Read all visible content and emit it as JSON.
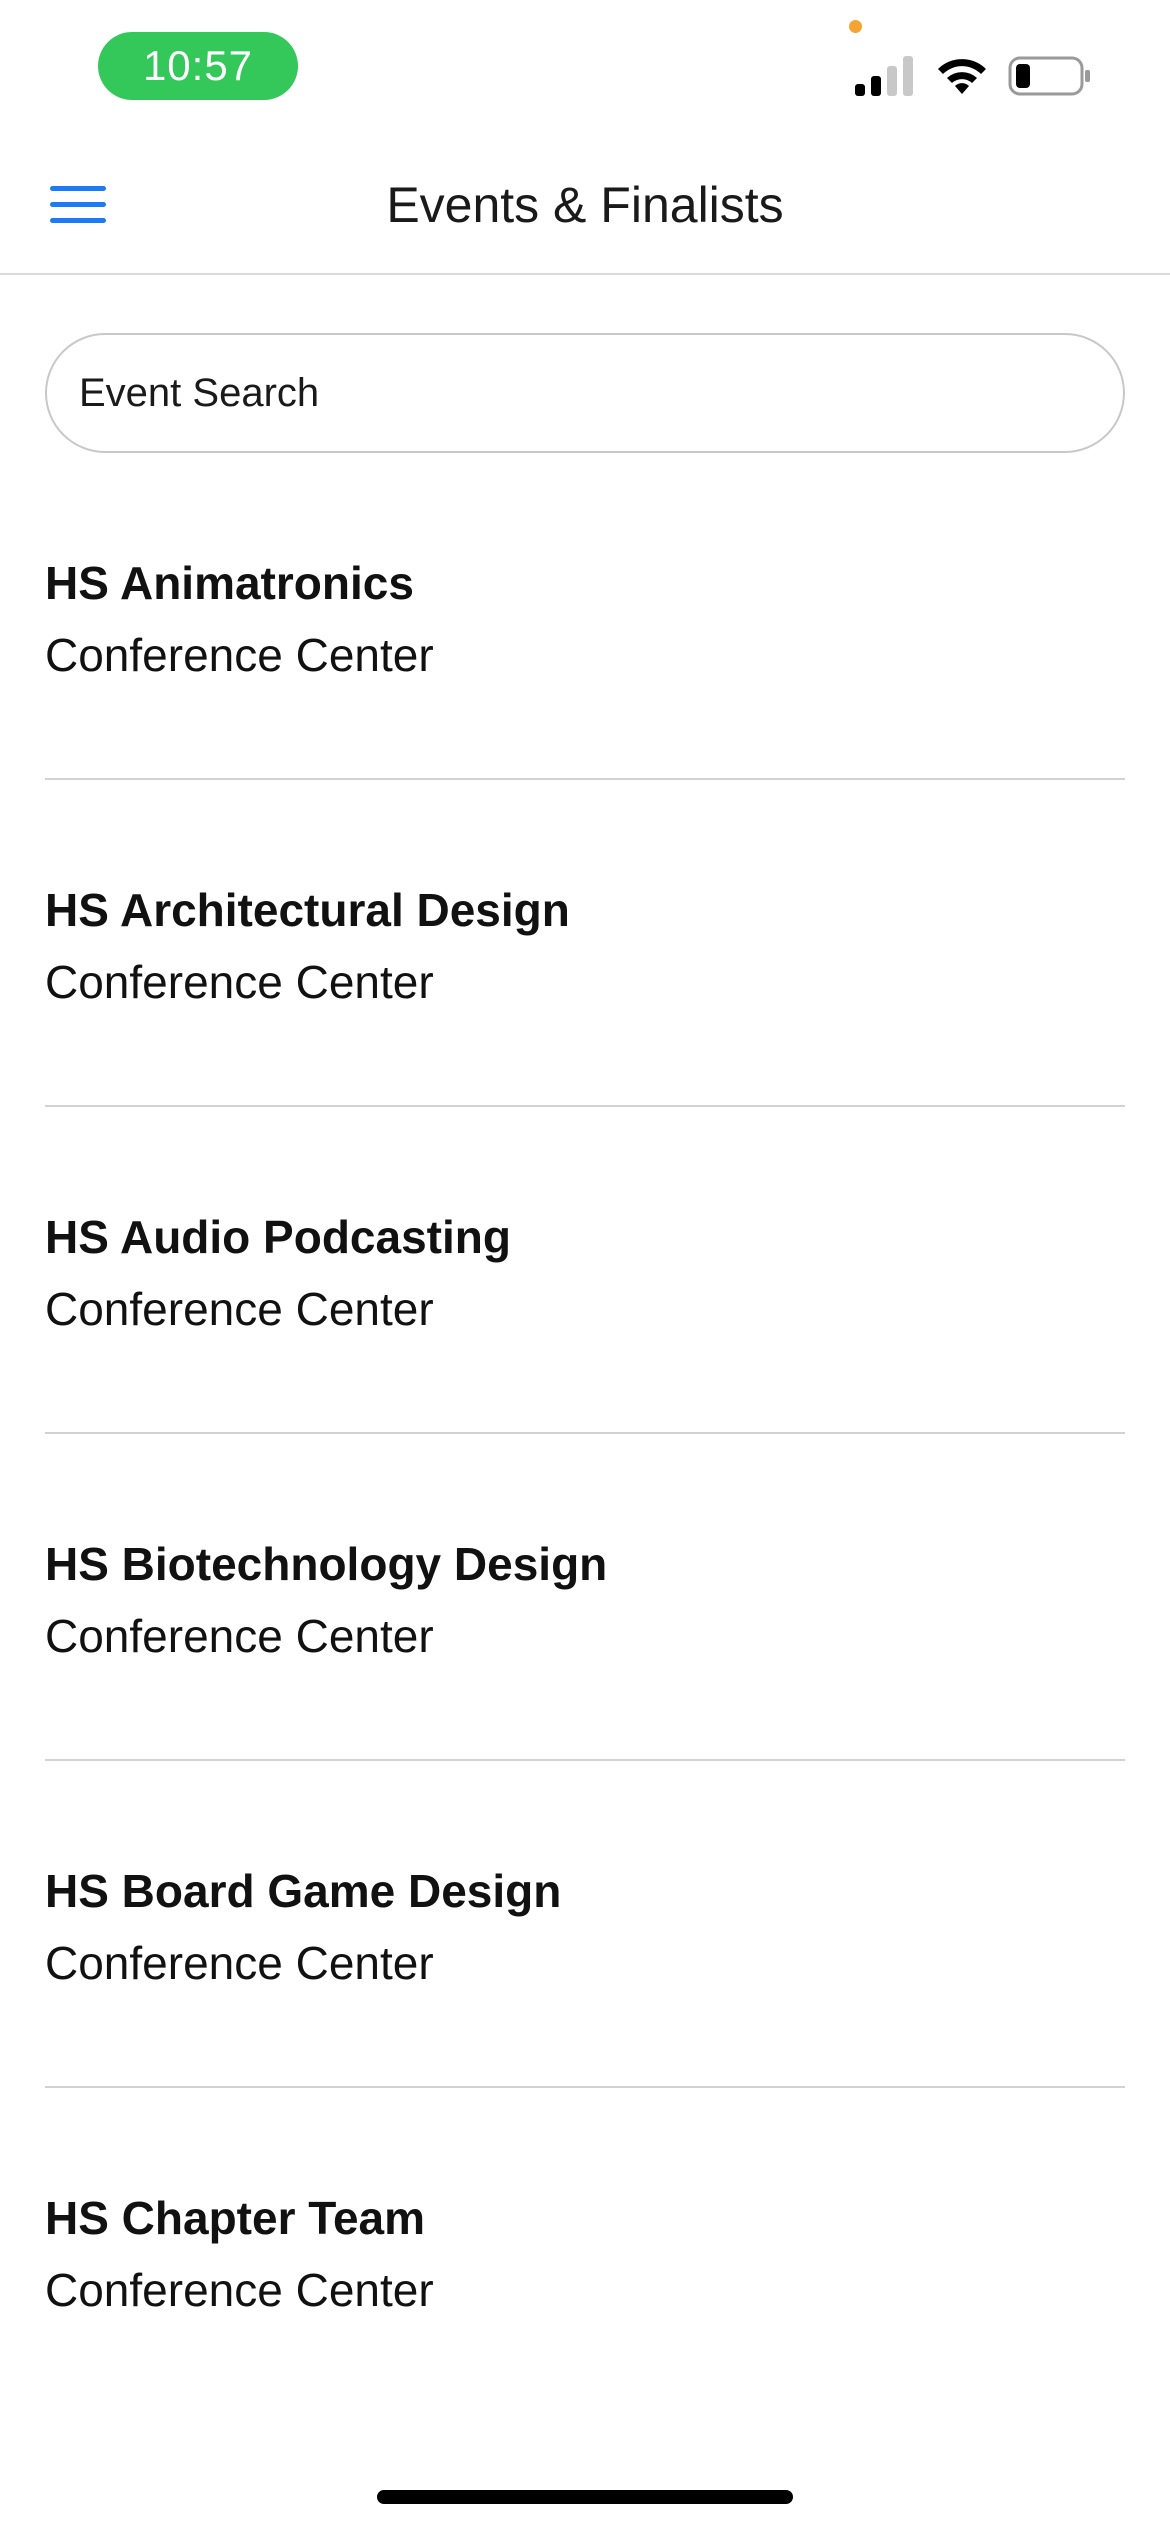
{
  "status_bar": {
    "time": "10:57",
    "time_pill_color": "#34c759",
    "privacy_indicator_color": "#f4a531",
    "icons": [
      "signal-icon",
      "wifi-icon",
      "battery-icon"
    ]
  },
  "nav": {
    "title": "Events & Finalists",
    "menu_icon": "hamburger-menu-icon",
    "accent_color": "#1a7cf0"
  },
  "search": {
    "placeholder": "Event Search",
    "value": ""
  },
  "events": [
    {
      "name": "HS Animatronics",
      "location": "Conference Center"
    },
    {
      "name": "HS Architectural Design",
      "location": "Conference Center"
    },
    {
      "name": "HS Audio Podcasting",
      "location": "Conference Center"
    },
    {
      "name": "HS Biotechnology Design",
      "location": "Conference Center"
    },
    {
      "name": "HS Board Game Design",
      "location": "Conference Center"
    },
    {
      "name": "HS Chapter Team",
      "location": "Conference Center"
    }
  ]
}
